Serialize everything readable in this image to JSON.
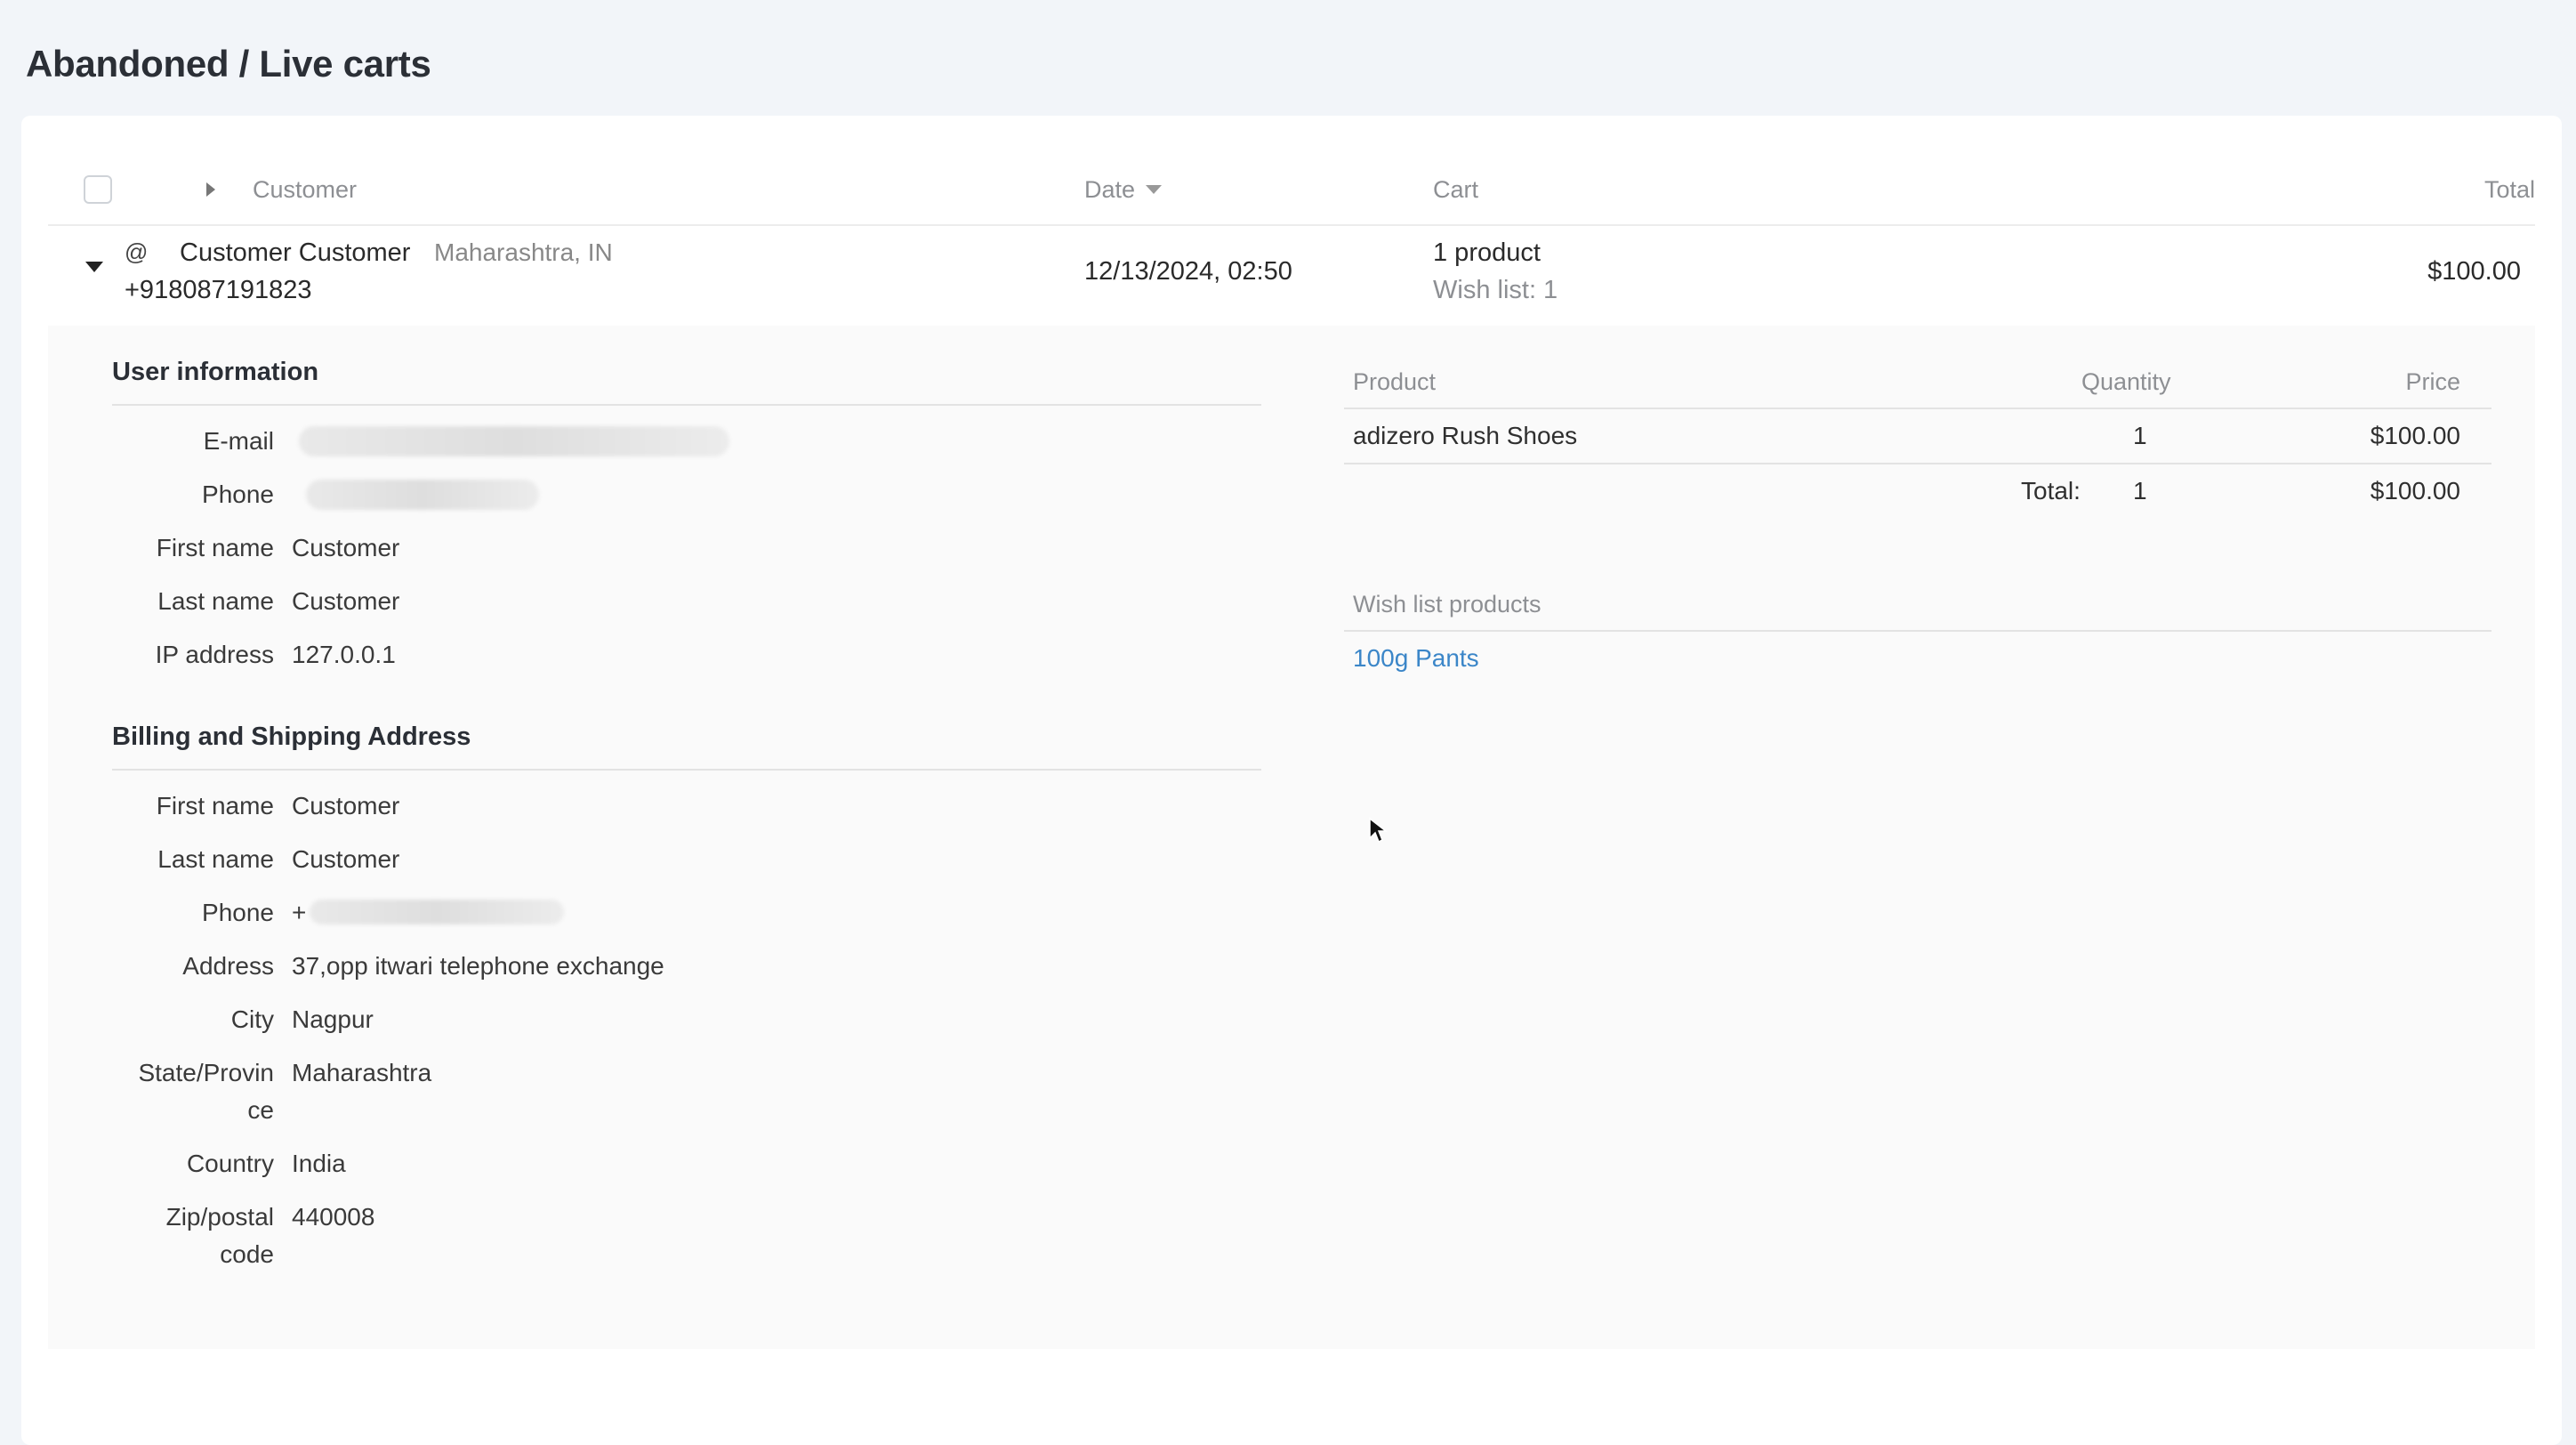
{
  "page": {
    "title": "Abandoned / Live carts"
  },
  "table": {
    "headers": {
      "customer": "Customer",
      "date": "Date",
      "cart": "Cart",
      "total": "Total"
    }
  },
  "row": {
    "customer_name": "Customer Customer",
    "customer_location": "Maharashtra, IN",
    "customer_phone": "+918087191823",
    "date": "12/13/2024, 02:50",
    "cart_summary": "1 product",
    "wish_summary": "Wish list: 1",
    "total": "$100.00"
  },
  "user_info": {
    "title": "User information",
    "email_label": "E-mail",
    "phone_label": "Phone",
    "first_name_label": "First name",
    "first_name": "Customer",
    "last_name_label": "Last name",
    "last_name": "Customer",
    "ip_label": "IP address",
    "ip": "127.0.0.1"
  },
  "address": {
    "title": "Billing and Shipping Address",
    "first_name_label": "First name",
    "first_name": "Customer",
    "last_name_label": "Last name",
    "last_name": "Customer",
    "phone_label": "Phone",
    "phone_prefix": "+",
    "address_label": "Address",
    "address": "37,opp itwari telephone exchange",
    "city_label": "City",
    "city": "Nagpur",
    "state_label_1": "State/Provin",
    "state_label_2": "ce",
    "state": "Maharashtra",
    "country_label": "Country",
    "country": "India",
    "zip_label_1": "Zip/postal",
    "zip_label_2": "code",
    "zip": "440008"
  },
  "products": {
    "headers": {
      "product": "Product",
      "quantity": "Quantity",
      "price": "Price"
    },
    "items": [
      {
        "name": "adizero Rush Shoes",
        "quantity": "1",
        "price": "$100.00"
      }
    ],
    "total_label": "Total:",
    "total_quantity": "1",
    "total_price": "$100.00"
  },
  "wish_list": {
    "title": "Wish list products",
    "items": [
      "100g Pants"
    ]
  }
}
